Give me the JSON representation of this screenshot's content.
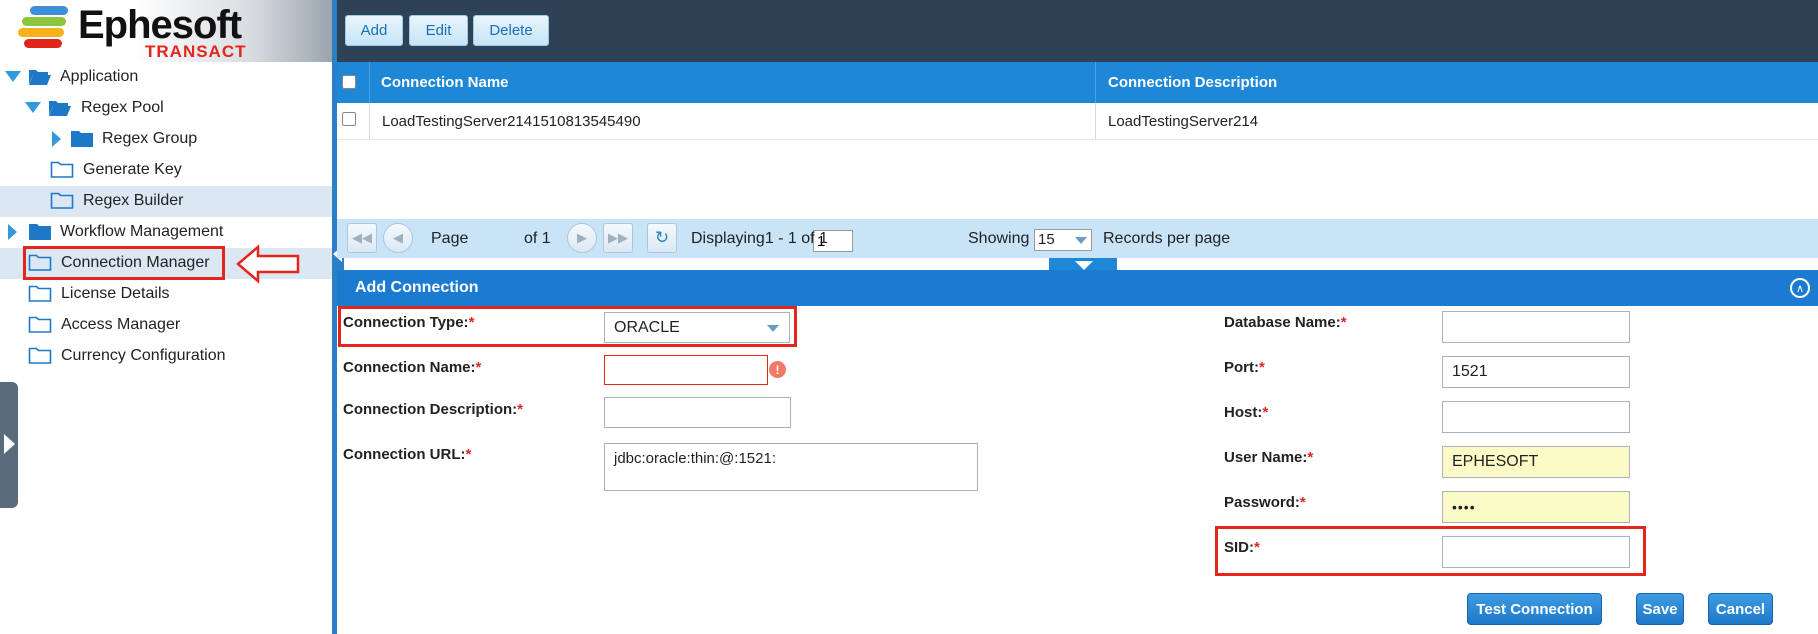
{
  "logo": {
    "name": "Ephesoft",
    "tagline": "TRANSACT"
  },
  "tree": {
    "items": [
      {
        "label": "Application",
        "icon": "folder-open-icon"
      },
      {
        "label": "Regex Pool",
        "icon": "folder-open-icon"
      },
      {
        "label": "Regex Group",
        "icon": "folder-icon"
      },
      {
        "label": "Generate Key",
        "icon": "folder-outline-icon"
      },
      {
        "label": "Regex Builder",
        "icon": "folder-outline-icon"
      },
      {
        "label": "Workflow Management",
        "icon": "folder-icon"
      },
      {
        "label": "Connection Manager",
        "icon": "folder-outline-icon"
      },
      {
        "label": "License Details",
        "icon": "folder-outline-icon"
      },
      {
        "label": "Access Manager",
        "icon": "folder-outline-icon"
      },
      {
        "label": "Currency Configuration",
        "icon": "folder-outline-icon"
      }
    ]
  },
  "toolbar": {
    "add": "Add",
    "edit": "Edit",
    "delete": "Delete"
  },
  "grid": {
    "columns": [
      "Connection Name",
      "Connection Description"
    ],
    "rows": [
      {
        "name": "LoadTestingServer2141510813545490",
        "description": "LoadTestingServer214"
      }
    ]
  },
  "pager": {
    "page_label": "Page",
    "page_value": "1",
    "of_label": "of 1",
    "displaying": "Displaying1 - 1 of 1",
    "showing_label": "Showing",
    "per_page": "15",
    "records_label": "Records per page"
  },
  "form": {
    "title": "Add Connection",
    "required_mark": "*",
    "connection_type_label": "Connection Type:",
    "connection_type_value": "ORACLE",
    "connection_name_label": "Connection Name:",
    "connection_name_value": "",
    "connection_description_label": "Connection Description:",
    "connection_description_value": "",
    "connection_url_label": "Connection URL:",
    "connection_url_value": "jdbc:oracle:thin:@:1521:",
    "database_name_label": "Database Name:",
    "database_name_value": "",
    "port_label": "Port:",
    "port_value": "1521",
    "host_label": "Host:",
    "host_value": "",
    "user_name_label": "User Name:",
    "user_name_value": "EPHESOFT",
    "password_label": "Password:",
    "password_value": "••••",
    "sid_label": "SID:",
    "sid_value": ""
  },
  "actions": {
    "test": "Test Connection",
    "save": "Save",
    "cancel": "Cancel"
  },
  "colors": {
    "accent": "#1e88d6",
    "header_dark": "#2e4155",
    "highlight_red": "#e2261b",
    "autofill_yellow": "#fbfbc8"
  }
}
